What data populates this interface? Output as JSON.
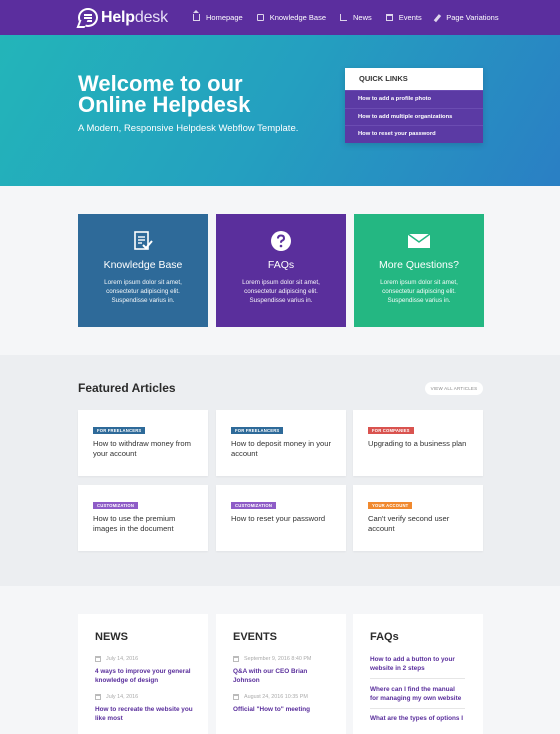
{
  "nav": {
    "logo_bold": "Help",
    "logo_light": "desk",
    "links": [
      {
        "label": "Homepage",
        "icon": "home-icon"
      },
      {
        "label": "Knowledge Base",
        "icon": "book-icon"
      },
      {
        "label": "News",
        "icon": "news-icon"
      },
      {
        "label": "Events",
        "icon": "calendar-icon"
      },
      {
        "label": "Page Variations",
        "icon": "pencil-icon"
      }
    ]
  },
  "hero": {
    "title_line1": "Welcome to our",
    "title_line2": "Online Helpdesk",
    "subtitle": "A Modern, Responsive Helpdesk Webflow Template.",
    "quick_links": {
      "heading": "QUICK LINKS",
      "items": [
        "How to add a profile photo",
        "How to add multiple organizations",
        "How to reset your password"
      ]
    }
  },
  "feature_cards": [
    {
      "title": "Knowledge Base",
      "text": "Lorem ipsum dolor sit amet, consectetur adipiscing elit. Suspendisse varius in.",
      "color": "#2e6a99",
      "icon": "checklist-icon"
    },
    {
      "title": "FAQs",
      "text": "Lorem ipsum dolor sit amet, consectetur adipiscing elit. Suspendisse varius in.",
      "color": "#5a2f9c",
      "icon": "question-icon"
    },
    {
      "title": "More Questions?",
      "text": "Lorem ipsum dolor sit amet, consectetur adipiscing elit. Suspendisse varius in.",
      "color": "#24b782",
      "icon": "mail-icon"
    }
  ],
  "featured": {
    "title": "Featured Articles",
    "view_all": "VIEW ALL ARTICLES",
    "articles": [
      {
        "tag": "FOR FREELANCERS",
        "tag_color": "#2e6a99",
        "title": "How to withdraw money from your account"
      },
      {
        "tag": "FOR FREELANCERS",
        "tag_color": "#2e6a99",
        "title": "How to deposit money in your account"
      },
      {
        "tag": "FOR COMPANIES",
        "tag_color": "#d9534f",
        "title": "Upgrading to a business plan"
      },
      {
        "tag": "CUSTOMIZATION",
        "tag_color": "#8e5cc7",
        "title": "How to use the premium images in the document"
      },
      {
        "tag": "CUSTOMIZATION",
        "tag_color": "#8e5cc7",
        "title": "How to reset your password"
      },
      {
        "tag": "YOUR ACCOUNT",
        "tag_color": "#f0892f",
        "title": "Can't verify second user account"
      }
    ]
  },
  "news": {
    "title": "NEWS",
    "items": [
      {
        "date": "July 14, 2016",
        "title": "4 ways to improve your general knowledge of design"
      },
      {
        "date": "July 14, 2016",
        "title": "How to recreate the website you like most"
      }
    ]
  },
  "events": {
    "title": "EVENTS",
    "items": [
      {
        "date": "September 9, 2016 8:40 PM",
        "title": "Q&A with our CEO Brian Johnson"
      },
      {
        "date": "August 24, 2016 10:35 PM",
        "title": "Official \"How to\" meeting"
      }
    ]
  },
  "faqs": {
    "title": "FAQs",
    "items": [
      "How to add a button to your website in 2 steps",
      "Where can I find the manual for managing my own website",
      "What are the types of options I"
    ]
  }
}
